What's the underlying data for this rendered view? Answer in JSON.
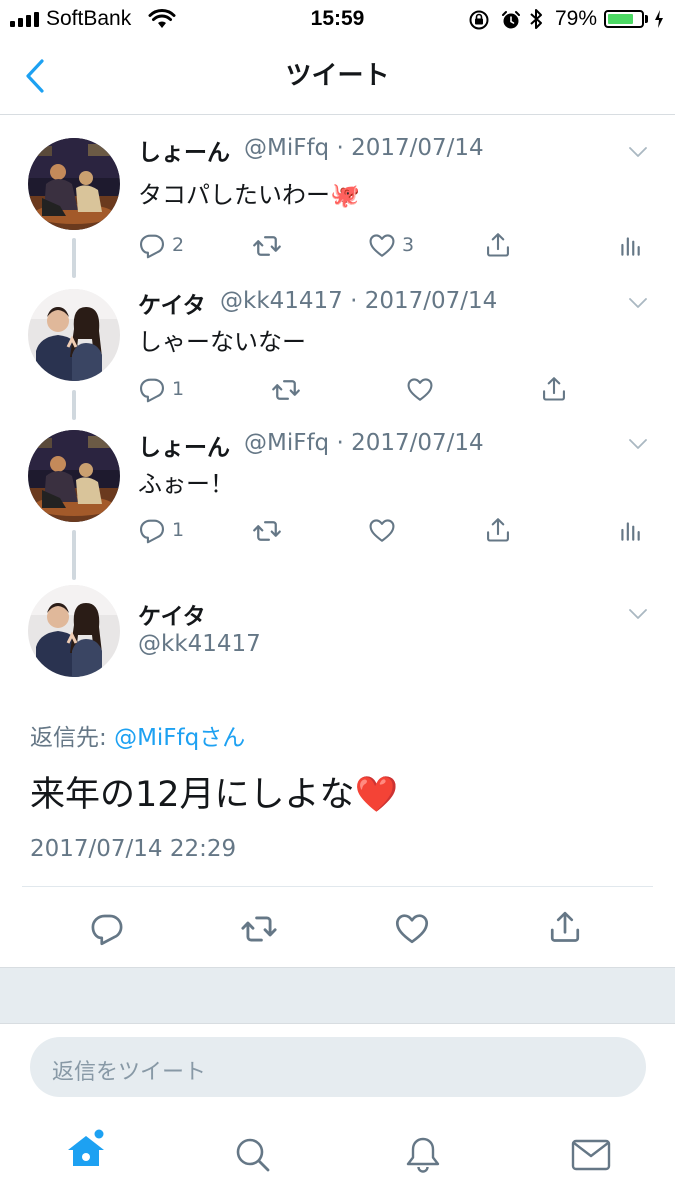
{
  "status_bar": {
    "carrier": "SoftBank",
    "time": "15:59",
    "battery_pct": "79%",
    "battery_level": 0.79
  },
  "nav": {
    "title": "ツイート"
  },
  "thread": [
    {
      "name": "しょーん",
      "handle_date": "@MiFfq · 2017/07/14",
      "text": "タコパしたいわー🐙",
      "replies": "2",
      "likes": "3"
    },
    {
      "name": "ケイタ",
      "handle_date": "@kk41417 · 2017/07/14",
      "text": "しゃーないなー",
      "replies": "1"
    },
    {
      "name": "しょーん",
      "handle_date": "@MiFfq · 2017/07/14",
      "text": "ふぉー！",
      "replies": "1"
    }
  ],
  "main_tweet": {
    "name": "ケイタ",
    "handle": "@kk41417",
    "reply_to_label": "返信先: ",
    "reply_to_mention": "@MiFfqさん",
    "text": "来年の12月にしよな❤️",
    "timestamp": "2017/07/14 22:29"
  },
  "reply_input": {
    "placeholder": "返信をツイート"
  },
  "tabs": [
    "home-icon",
    "search-icon",
    "notifications-icon",
    "messages-icon"
  ],
  "colors": {
    "accent": "#1da1f2",
    "secondary_text": "#657786",
    "battery": "#4cd964"
  }
}
